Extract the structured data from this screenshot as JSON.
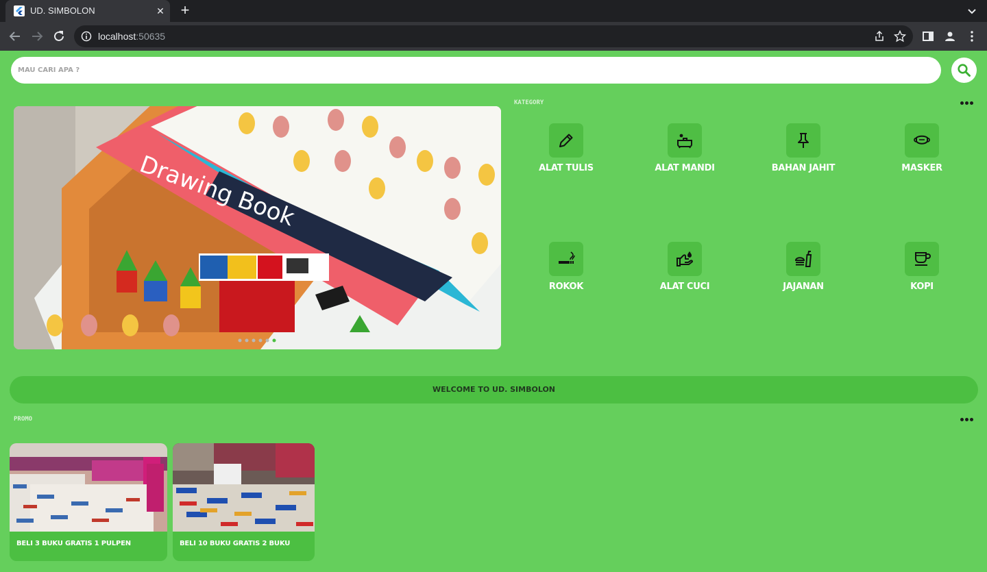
{
  "browser": {
    "tab_title": "UD. SIMBOLON",
    "url_host": "localhost",
    "url_port": ":50635"
  },
  "search": {
    "placeholder": "MAU CARI APA ?",
    "value": ""
  },
  "banner": {
    "image": "drawing-book-photo",
    "slides_count": 6,
    "active_slide": 6
  },
  "category": {
    "title": "KATEGORY",
    "items": [
      {
        "label": "ALAT TULIS",
        "icon": "pencil-icon"
      },
      {
        "label": "ALAT MANDI",
        "icon": "bathtub-icon"
      },
      {
        "label": "BAHAN JAHIT",
        "icon": "push-pin-icon"
      },
      {
        "label": "MASKER",
        "icon": "mask-icon"
      },
      {
        "label": "ROKOK",
        "icon": "smoking-icon"
      },
      {
        "label": "ALAT CUCI",
        "icon": "wash-hands-icon"
      },
      {
        "label": "JAJANAN",
        "icon": "fastfood-icon"
      },
      {
        "label": "KOPI",
        "icon": "coffee-icon"
      }
    ]
  },
  "welcome": {
    "text": "WELCOME TO UD. SIMBOLON"
  },
  "promo": {
    "title": "PROMO",
    "items": [
      {
        "text": "BELI 3 BUKU GRATIS 1 PULPEN",
        "image": "book-store-photo-1"
      },
      {
        "text": "BELI 10 BUKU GRATIS 2 BUKU",
        "image": "book-store-photo-2"
      }
    ]
  },
  "colors": {
    "background": "#65cf5c",
    "tile": "#4fbe44",
    "banner_accent": "#4cbf42"
  }
}
